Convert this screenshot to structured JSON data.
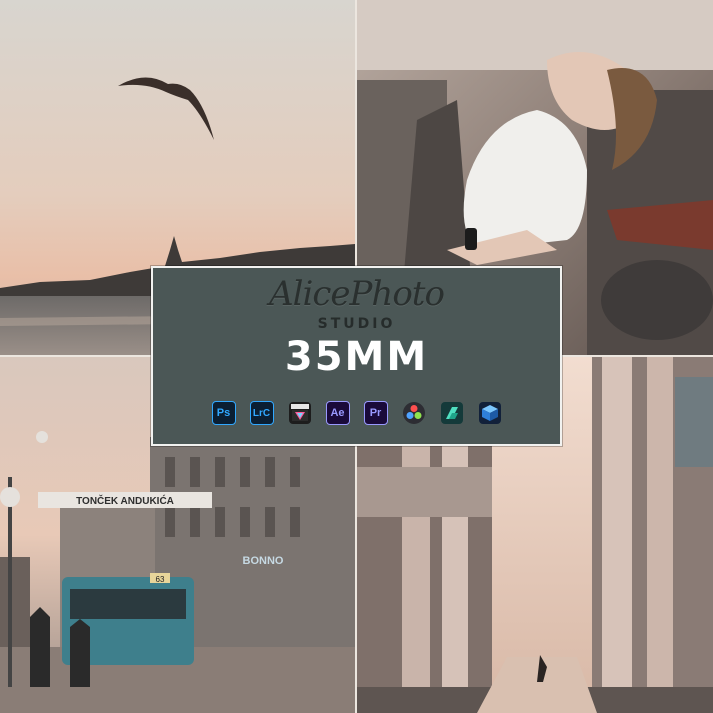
{
  "branding": {
    "studio_name": "AlicePhoto",
    "studio_label": "STUDIO",
    "preset_name": "35MM"
  },
  "sign": {
    "text": "TONČEK ANDUKIĆA"
  },
  "storefront": {
    "text": "BONNO"
  },
  "tram": {
    "number": "63"
  },
  "apps": [
    {
      "label": "Ps",
      "icon": "photoshop-icon"
    },
    {
      "label": "LrC",
      "icon": "lightroom-classic-icon"
    },
    {
      "label": "",
      "icon": "final-cut-icon"
    },
    {
      "label": "Ae",
      "icon": "after-effects-icon"
    },
    {
      "label": "Pr",
      "icon": "premiere-pro-icon"
    },
    {
      "label": "",
      "icon": "davinci-resolve-icon"
    },
    {
      "label": "",
      "icon": "filmora-icon"
    },
    {
      "label": "",
      "icon": "cube-icon"
    }
  ],
  "colors": {
    "panel": "#4b5756",
    "panel_border": "#f2f2f0",
    "brand_text": "#2a302f",
    "preset_text": "#ffffff",
    "sky_tone": "#e8c9b7"
  }
}
